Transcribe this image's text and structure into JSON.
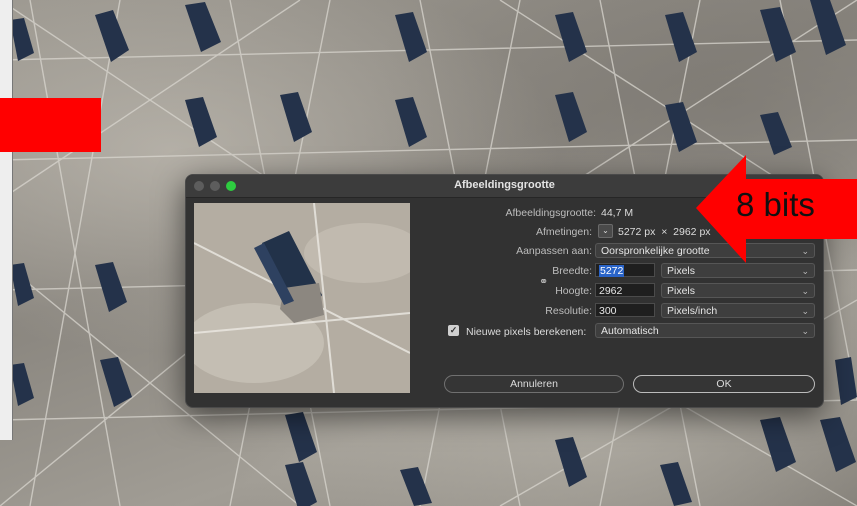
{
  "dialog": {
    "title": "Afbeeldingsgrootte",
    "image_size": {
      "label": "Afbeeldingsgrootte:",
      "value": "44,7 M"
    },
    "dimensions": {
      "label": "Afmetingen:",
      "value": "5272 px  ×  2962 px"
    },
    "fit_to": {
      "label": "Aanpassen aan:",
      "value": "Oorspronkelijke grootte"
    },
    "width": {
      "label": "Breedte:",
      "value": "5272",
      "unit": "Pixels"
    },
    "height": {
      "label": "Hoogte:",
      "value": "2962",
      "unit": "Pixels"
    },
    "resolution": {
      "label": "Resolutie:",
      "value": "300",
      "unit": "Pixels/inch"
    },
    "resample": {
      "label": "Nieuwe pixels berekenen:",
      "checked": true,
      "value": "Automatisch"
    },
    "buttons": {
      "cancel": "Annuleren",
      "ok": "OK"
    }
  },
  "annotation": {
    "text": "8 bits",
    "color": "#ff0000"
  },
  "colors": {
    "accent": "#2a64c8",
    "dialog_bg": "#323232",
    "green_light": "#2ecc40"
  },
  "icons": {
    "link": "chain-link-icon",
    "chevron": "chevron-down-icon",
    "check": "checkmark-icon"
  }
}
